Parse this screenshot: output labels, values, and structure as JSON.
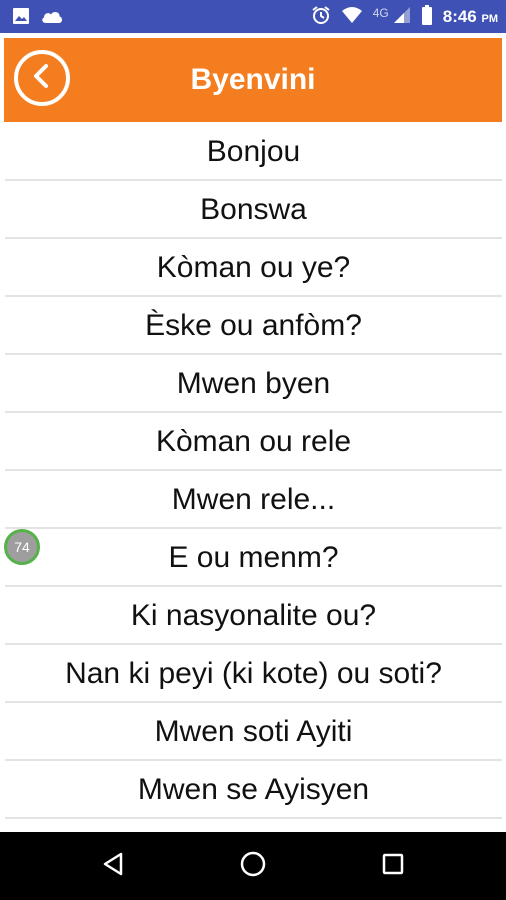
{
  "status_bar": {
    "network_label": "4G",
    "time": "8:46",
    "time_suffix": "PM",
    "icons": [
      "image-icon",
      "cloud-icon",
      "alarm-icon",
      "wifi-icon",
      "signal-icon",
      "battery-icon"
    ]
  },
  "header": {
    "title": "Byenvini",
    "back_icon": "chevron-left-icon",
    "color": "#F47D20"
  },
  "phrases": [
    "Bonjou",
    "Bonswa",
    "Kòman ou ye?",
    "Èske ou anfòm?",
    "Mwen byen",
    "Kòman ou rele",
    "Mwen rele...",
    "E ou menm?",
    "Ki nasyonalite ou?",
    "Nan ki peyi (ki kote) ou soti?",
    "Mwen soti Ayiti",
    "Mwen se Ayisyen"
  ],
  "floating_badge": "74",
  "nav_bar": {
    "icons": [
      "back-triangle-icon",
      "home-circle-icon",
      "recents-square-icon"
    ]
  }
}
